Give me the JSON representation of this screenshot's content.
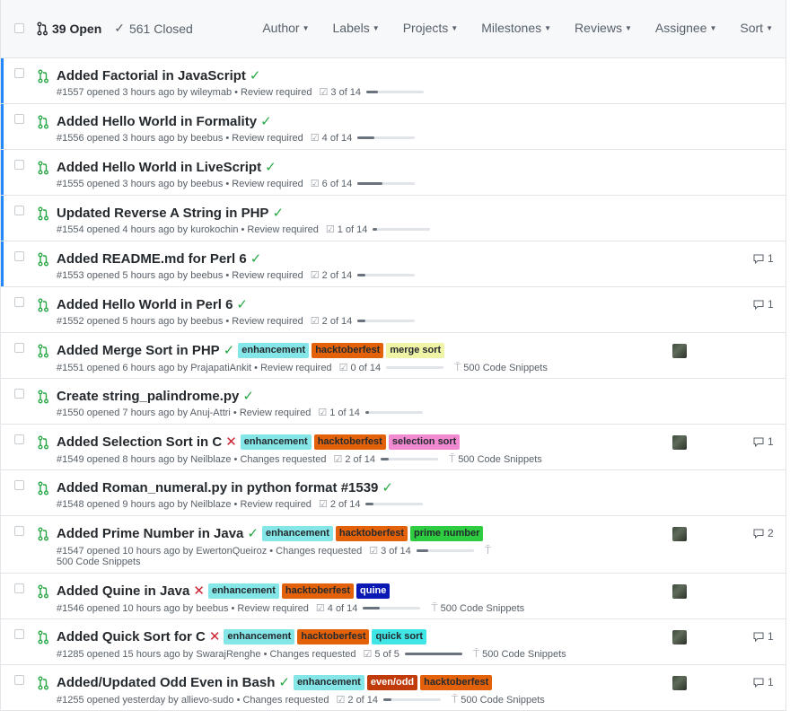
{
  "header": {
    "open_label": "39 Open",
    "closed_label": "561 Closed",
    "filters": [
      "Author",
      "Labels",
      "Projects",
      "Milestones",
      "Reviews",
      "Assignee",
      "Sort"
    ]
  },
  "colors": {
    "open": "#28a745",
    "unread": "#2188ff",
    "enhancement": "#84e6e6",
    "hacktoberfest": "#e36209",
    "merge_sort": "#f0f4a6",
    "selection_sort": "#f28ad2",
    "prime_number": "#2ecc40",
    "quine": "#0a19b4",
    "quick_sort": "#40e6e6",
    "even_odd": "#c13a0a"
  },
  "rows": [
    {
      "title": "Added Factorial in JavaScript",
      "status": "success",
      "status_glyph": "✓",
      "labels": [],
      "meta": "#1557 opened 3 hours ago by wileymab • Review required",
      "tasks": "3 of 14",
      "task_fraction": 0.214,
      "milestone": "",
      "avatar": false,
      "comments": "",
      "unread": true
    },
    {
      "title": "Added Hello World in Formality",
      "status": "success",
      "status_glyph": "✓",
      "labels": [],
      "meta": "#1556 opened 3 hours ago by beebus • Review required",
      "tasks": "4 of 14",
      "task_fraction": 0.286,
      "milestone": "",
      "avatar": false,
      "comments": "",
      "unread": true
    },
    {
      "title": "Added Hello World in LiveScript",
      "status": "success",
      "status_glyph": "✓",
      "labels": [],
      "meta": "#1555 opened 3 hours ago by beebus • Review required",
      "tasks": "6 of 14",
      "task_fraction": 0.429,
      "milestone": "",
      "avatar": false,
      "comments": "",
      "unread": true
    },
    {
      "title": "Updated Reverse A String in PHP",
      "status": "success",
      "status_glyph": "✓",
      "labels": [],
      "meta": "#1554 opened 4 hours ago by kurokochin • Review required",
      "tasks": "1 of 14",
      "task_fraction": 0.071,
      "milestone": "",
      "avatar": false,
      "comments": "",
      "unread": true
    },
    {
      "title": "Added README.md for Perl 6",
      "status": "success",
      "status_glyph": "✓",
      "labels": [],
      "meta": "#1553 opened 5 hours ago by beebus • Review required",
      "tasks": "2 of 14",
      "task_fraction": 0.143,
      "milestone": "",
      "avatar": false,
      "comments": "1",
      "unread": true
    },
    {
      "title": "Added Hello World in Perl 6",
      "status": "success",
      "status_glyph": "✓",
      "labels": [],
      "meta": "#1552 opened 5 hours ago by beebus • Review required",
      "tasks": "2 of 14",
      "task_fraction": 0.143,
      "milestone": "",
      "avatar": false,
      "comments": "1",
      "unread": false
    },
    {
      "title": "Added Merge Sort in PHP",
      "status": "success",
      "status_glyph": "✓",
      "labels": [
        {
          "text": "enhancement",
          "color": "#84e6e6",
          "fg": "#24292e"
        },
        {
          "text": "hacktoberfest",
          "color": "#e36209",
          "fg": "#24292e"
        },
        {
          "text": "merge sort",
          "color": "#f0f4a6",
          "fg": "#24292e"
        }
      ],
      "meta": "#1551 opened 6 hours ago by PrajapatiAnkit • Review required",
      "tasks": "0 of 14",
      "task_fraction": 0.0,
      "milestone": "500 Code Snippets",
      "avatar": true,
      "comments": "",
      "unread": false
    },
    {
      "title": "Create string_palindrome.py",
      "status": "success",
      "status_glyph": "✓",
      "labels": [],
      "meta": "#1550 opened 7 hours ago by Anuj-Attri • Review required",
      "tasks": "1 of 14",
      "task_fraction": 0.071,
      "milestone": "",
      "avatar": false,
      "comments": "",
      "unread": false
    },
    {
      "title": "Added Selection Sort in C",
      "status": "failure",
      "status_glyph": "✕",
      "labels": [
        {
          "text": "enhancement",
          "color": "#84e6e6",
          "fg": "#24292e"
        },
        {
          "text": "hacktoberfest",
          "color": "#e36209",
          "fg": "#24292e"
        },
        {
          "text": "selection sort",
          "color": "#f28ad2",
          "fg": "#24292e"
        }
      ],
      "meta": "#1549 opened 8 hours ago by Neilblaze • Changes requested",
      "tasks": "2 of 14",
      "task_fraction": 0.143,
      "milestone": "500 Code Snippets",
      "avatar": true,
      "comments": "1",
      "unread": false
    },
    {
      "title": "Added Roman_numeral.py in python format #1539",
      "status": "success",
      "status_glyph": "✓",
      "labels": [],
      "meta": "#1548 opened 9 hours ago by Neilblaze • Review required",
      "tasks": "2 of 14",
      "task_fraction": 0.143,
      "milestone": "",
      "avatar": false,
      "comments": "",
      "unread": false
    },
    {
      "title": "Added Prime Number in Java",
      "status": "success",
      "status_glyph": "✓",
      "labels": [
        {
          "text": "enhancement",
          "color": "#84e6e6",
          "fg": "#24292e"
        },
        {
          "text": "hacktoberfest",
          "color": "#e36209",
          "fg": "#24292e"
        },
        {
          "text": "prime number",
          "color": "#2ecc40",
          "fg": "#24292e"
        }
      ],
      "meta": "#1547 opened 10 hours ago by EwertonQueiroz • Changes requested",
      "tasks": "3 of 14",
      "task_fraction": 0.214,
      "milestone": "",
      "milestone_wrap": "500 Code Snippets",
      "avatar": true,
      "comments": "2",
      "unread": false
    },
    {
      "title": "Added Quine in Java",
      "status": "failure",
      "status_glyph": "✕",
      "labels": [
        {
          "text": "enhancement",
          "color": "#84e6e6",
          "fg": "#24292e"
        },
        {
          "text": "hacktoberfest",
          "color": "#e36209",
          "fg": "#24292e"
        },
        {
          "text": "quine",
          "color": "#0a19b4",
          "fg": "#ffffff"
        }
      ],
      "meta": "#1546 opened 10 hours ago by beebus • Review required",
      "tasks": "4 of 14",
      "task_fraction": 0.286,
      "milestone": "500 Code Snippets",
      "avatar": true,
      "comments": "",
      "unread": false
    },
    {
      "title": "Added Quick Sort for C",
      "status": "failure",
      "status_glyph": "✕",
      "labels": [
        {
          "text": "enhancement",
          "color": "#84e6e6",
          "fg": "#24292e"
        },
        {
          "text": "hacktoberfest",
          "color": "#e36209",
          "fg": "#24292e"
        },
        {
          "text": "quick sort",
          "color": "#40e6e6",
          "fg": "#24292e"
        }
      ],
      "meta": "#1285 opened 15 hours ago by SwarajRenghe • Changes requested",
      "tasks": "5 of 5",
      "task_fraction": 1.0,
      "milestone": "500 Code Snippets",
      "avatar": true,
      "comments": "1",
      "unread": false
    },
    {
      "title": "Added/Updated Odd Even in Bash",
      "status": "success",
      "status_glyph": "✓",
      "labels": [
        {
          "text": "enhancement",
          "color": "#84e6e6",
          "fg": "#24292e"
        },
        {
          "text": "even/odd",
          "color": "#c13a0a",
          "fg": "#ffffff"
        },
        {
          "text": "hacktoberfest",
          "color": "#e36209",
          "fg": "#24292e"
        }
      ],
      "meta": "#1255 opened yesterday by allievo-sudo • Changes requested",
      "tasks": "2 of 14",
      "task_fraction": 0.143,
      "milestone": "500 Code Snippets",
      "avatar": true,
      "comments": "1",
      "unread": false
    }
  ]
}
